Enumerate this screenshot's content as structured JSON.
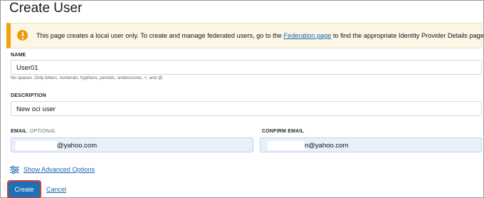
{
  "page": {
    "title": "Create User"
  },
  "banner": {
    "text_before": "This page creates a local user only. To create and manage federated users, go to the ",
    "link_text": "Federation page",
    "text_after": " to find the appropriate Identity Provider Details page."
  },
  "form": {
    "name": {
      "label": "NAME",
      "value": "User01",
      "hint": "No spaces. Only letters, numerals, hyphens, periods, underscores, +, and @."
    },
    "description": {
      "label": "DESCRIPTION",
      "value": "New oci user"
    },
    "email": {
      "label": "EMAIL",
      "optional": "OPTIONAL",
      "value_visible": "@yahoo.com"
    },
    "confirm_email": {
      "label": "CONFIRM EMAIL",
      "value_visible": "n@yahoo.com"
    }
  },
  "advanced": {
    "label": "Show Advanced Options",
    "icon": "sliders-icon"
  },
  "actions": {
    "create_label": "Create",
    "cancel_label": "Cancel"
  },
  "colors": {
    "accent": "#1d6fb8",
    "warning": "#f2a20e",
    "highlight": "#d63a2f"
  }
}
